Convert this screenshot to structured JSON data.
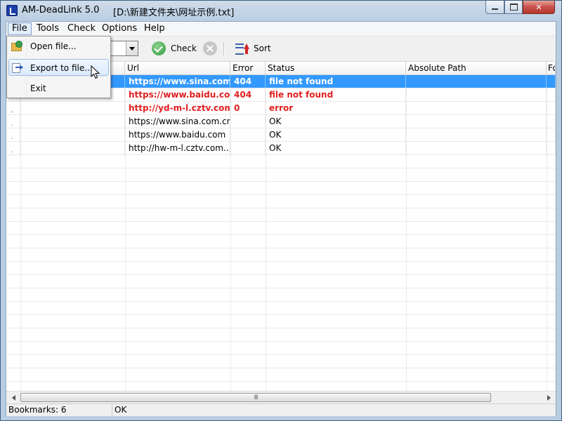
{
  "window": {
    "app_title": "AM-DeadLink 5.0",
    "file_path": "[D:\\新建文件夹\\网址示例.txt]",
    "close_glyph": "✕"
  },
  "menu": {
    "items": [
      "File",
      "Tools",
      "Check",
      "Options",
      "Help"
    ]
  },
  "file_menu": {
    "open": "Open file...",
    "export": "Export to file...",
    "exit": "Exit"
  },
  "toolbar": {
    "check_label": "Check",
    "sort_label": "Sort"
  },
  "table": {
    "columns": [
      "Url",
      "Error",
      "Status",
      "Absolute Path",
      "Fo"
    ],
    "rows": [
      {
        "url": "https://www.sina.com....",
        "error": "404",
        "status": "file not found",
        "state": "selected"
      },
      {
        "url": "https://www.baidu.co...",
        "error": "404",
        "status": "file not found",
        "state": "error"
      },
      {
        "url": "http://yd-m-l.cztv.com...",
        "error": "0",
        "status": "error",
        "state": "error"
      },
      {
        "url": "https://www.sina.com.cn",
        "error": "",
        "status": "OK",
        "state": "ok"
      },
      {
        "url": "https://www.baidu.com",
        "error": "",
        "status": "OK",
        "state": "ok"
      },
      {
        "url": "http://hw-m-l.cztv.com...",
        "error": "",
        "status": "OK",
        "state": "ok"
      }
    ]
  },
  "scrollbar": {
    "thumb_grip": "III"
  },
  "statusbar": {
    "bookmarks": "Bookmarks: 6",
    "status": "OK"
  },
  "colors": {
    "selected_row": "#3399ff",
    "error_text": "#e02020"
  }
}
